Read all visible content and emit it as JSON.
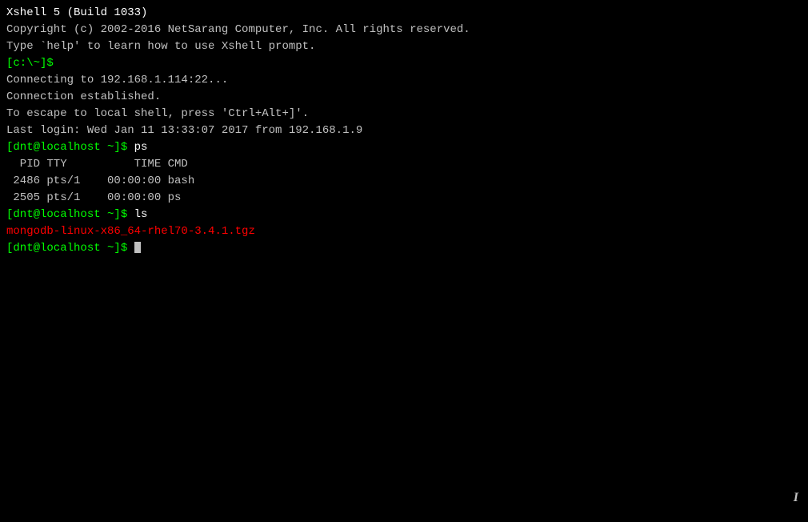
{
  "terminal": {
    "title": "Xshell 5 (Build 1033)",
    "lines": [
      {
        "id": "title",
        "text": "Xshell 5 (Build 1033)",
        "color": "white"
      },
      {
        "id": "copyright",
        "text": "Copyright (c) 2002-2016 NetSarang Computer, Inc. All rights reserved.",
        "color": "gray"
      },
      {
        "id": "blank1",
        "text": "",
        "color": "gray"
      },
      {
        "id": "help-hint",
        "text": "Type `help' to learn how to use Xshell prompt.",
        "color": "gray"
      },
      {
        "id": "local-prompt",
        "text": "[c:\\~]$",
        "color": "green"
      },
      {
        "id": "blank2",
        "text": "",
        "color": "gray"
      },
      {
        "id": "connecting",
        "text": "Connecting to 192.168.1.114:22...",
        "color": "gray"
      },
      {
        "id": "established",
        "text": "Connection established.",
        "color": "gray"
      },
      {
        "id": "escape-hint",
        "text": "To escape to local shell, press 'Ctrl+Alt+]'.",
        "color": "gray"
      },
      {
        "id": "blank3",
        "text": "",
        "color": "gray"
      },
      {
        "id": "last-login",
        "text": "Last login: Wed Jan 11 13:33:07 2017 from 192.168.1.9",
        "color": "gray"
      },
      {
        "id": "prompt-ps",
        "text": "[dnt@localhost ~]$ ps",
        "color": "green",
        "cmd": "ps"
      },
      {
        "id": "ps-header",
        "text": "  PID TTY          TIME CMD",
        "color": "gray"
      },
      {
        "id": "ps-row1",
        "text": " 2486 pts/1    00:00:00 bash",
        "color": "gray"
      },
      {
        "id": "ps-row2",
        "text": " 2505 pts/1    00:00:00 ps",
        "color": "gray"
      },
      {
        "id": "prompt-ls",
        "text": "[dnt@localhost ~]$ ls",
        "color": "green",
        "cmd": "ls"
      },
      {
        "id": "ls-output",
        "text": "mongodb-linux-x86_64-rhel70-3.4.1.tgz",
        "color": "red"
      },
      {
        "id": "prompt-current",
        "text": "[dnt@localhost ~]$ ",
        "color": "green",
        "hasCursor": true
      }
    ]
  }
}
